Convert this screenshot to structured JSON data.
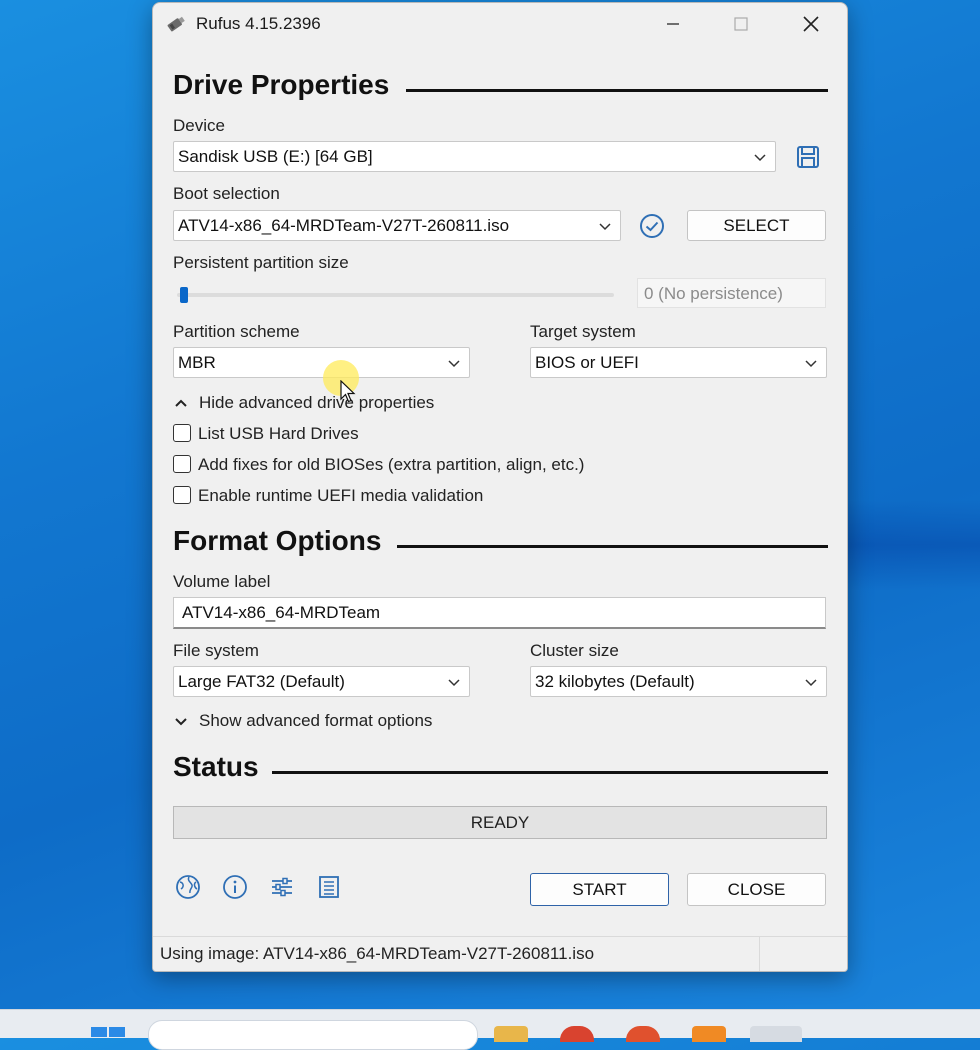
{
  "window": {
    "title": "Rufus 4.15.2396"
  },
  "drive_properties": {
    "heading": "Drive Properties",
    "device_label": "Device",
    "device_value": "Sandisk USB (E:) [64 GB]",
    "boot_label": "Boot selection",
    "boot_value": "ATV14-x86_64-MRDTeam-V27T-260811.iso",
    "select_button": "SELECT",
    "persistent_label": "Persistent partition size",
    "persistent_value": "0 (No persistence)",
    "partition_label": "Partition scheme",
    "partition_value": "MBR",
    "target_label": "Target system",
    "target_value": "BIOS or UEFI",
    "advanced_toggle": "Hide advanced drive properties",
    "options": [
      {
        "label": "List USB Hard Drives",
        "checked": false
      },
      {
        "label": "Add fixes for old BIOSes (extra partition, align, etc.)",
        "checked": false
      },
      {
        "label": "Enable runtime UEFI media validation",
        "checked": false
      }
    ]
  },
  "format_options": {
    "heading": "Format Options",
    "volume_label": "Volume label",
    "volume_value": "ATV14-x86_64-MRDTeam",
    "fs_label": "File system",
    "fs_value": "Large FAT32 (Default)",
    "cluster_label": "Cluster size",
    "cluster_value": "32 kilobytes (Default)",
    "advanced_toggle": "Show advanced format options"
  },
  "status": {
    "heading": "Status",
    "state": "READY"
  },
  "buttons": {
    "start": "START",
    "close": "CLOSE"
  },
  "footer": {
    "message": "Using image: ATV14-x86_64-MRDTeam-V27T-260811.iso"
  },
  "colors": {
    "accent": "#0a67c9",
    "window_bg": "#f0f0f0",
    "desktop": "#1277d0"
  }
}
